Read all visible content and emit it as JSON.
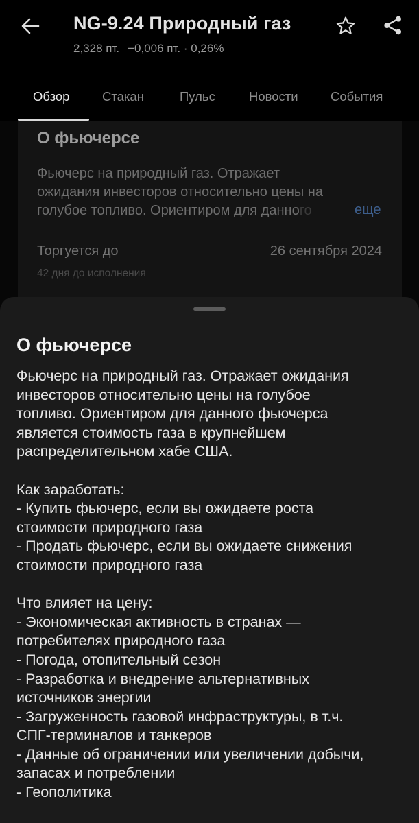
{
  "header": {
    "title": "NG-9.24 Природный газ",
    "price": "2,328 пт.",
    "change": "−0,006 пт. · 0,26%"
  },
  "tabs": [
    {
      "label": "Обзор",
      "active": true
    },
    {
      "label": "Стакан",
      "active": false
    },
    {
      "label": "Пульс",
      "active": false
    },
    {
      "label": "Новости",
      "active": false
    },
    {
      "label": "События",
      "active": false
    }
  ],
  "card": {
    "title": "О фьючерсе",
    "text_lines": [
      "Фьючерс на природный газ. Отражает",
      "ожидания инвесторов относительно цены на",
      "голубое топливо. Ориентиром для данно"
    ],
    "text_fade": "го",
    "more": "еще",
    "trade_label": "Торгуется до",
    "trade_date": "26 сентября 2024",
    "days_left": "42 дня до исполнения"
  },
  "sheet": {
    "title": "О фьючерсе",
    "lines": [
      "Фьючерс на природный газ. Отражает ожидания",
      "инвесторов относительно цены на голубое",
      "топливо. Ориентиром для данного фьючерса",
      "является стоимость газа в крупнейшем",
      "распределительном хабе США.",
      "",
      "Как заработать:",
      "- Купить фьючерс, если вы ожидаете роста",
      "стоимости природного газа",
      "- Продать фьючерс, если вы ожидаете снижения",
      "стоимости природного газа",
      "",
      "Что влияет на цену:",
      "- Экономическая активность в странах —",
      "потребителях природного газа",
      "- Погода, отопительный сезон",
      "- Разработка и внедрение альтернативных",
      "источников энергии",
      "- Загруженность газовой инфраструктуры, в т.ч.",
      "СПГ-терминалов и танкеров",
      "- Данные об ограничении или увеличении добычи,",
      "запасах и потреблении",
      "- Геополитика"
    ]
  },
  "colors": {
    "background": "#000000",
    "sheet": "#1b1b1b",
    "link": "#3d5e8c",
    "text": "#e6e6e6"
  },
  "icons": {
    "back": "arrow-left-icon",
    "favorite": "star-outline-icon",
    "share": "share-icon"
  }
}
